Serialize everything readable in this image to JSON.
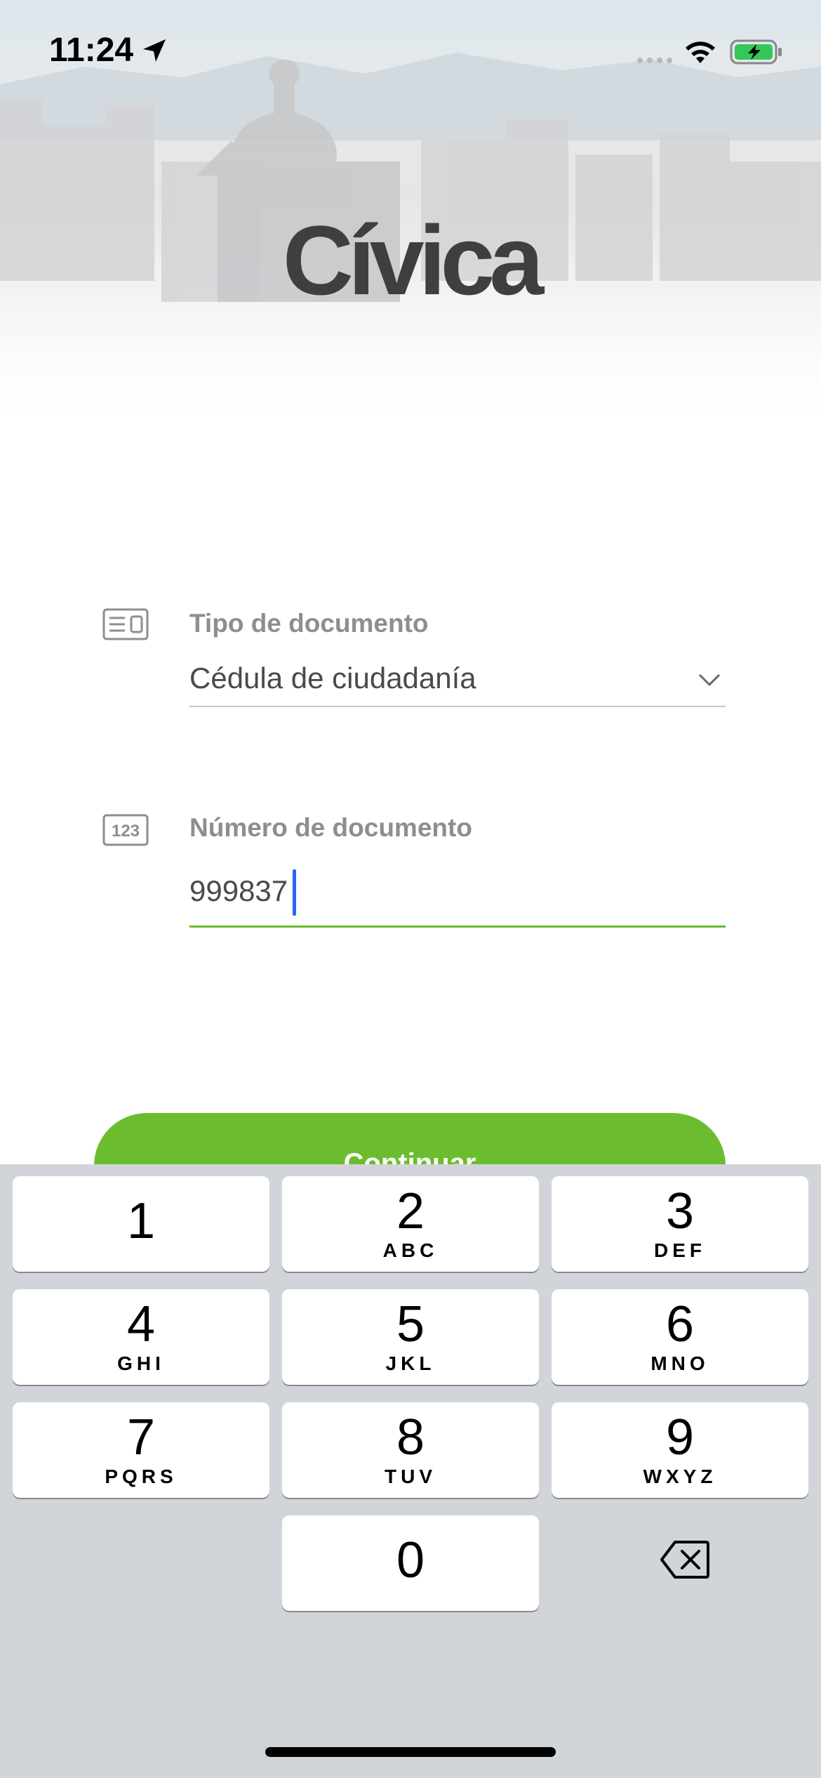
{
  "status_bar": {
    "time": "11:24"
  },
  "app": {
    "logo": "Cívica"
  },
  "form": {
    "document_type": {
      "label": "Tipo de documento",
      "value": "Cédula de ciudadanía",
      "icon": "id-card-icon"
    },
    "document_number": {
      "label": "Número de documento",
      "value": "999837",
      "icon": "numeric-123-icon"
    }
  },
  "actions": {
    "continue_label": "Continuar"
  },
  "keyboard": {
    "keys": [
      {
        "num": "1",
        "letters": ""
      },
      {
        "num": "2",
        "letters": "ABC"
      },
      {
        "num": "3",
        "letters": "DEF"
      },
      {
        "num": "4",
        "letters": "GHI"
      },
      {
        "num": "5",
        "letters": "JKL"
      },
      {
        "num": "6",
        "letters": "MNO"
      },
      {
        "num": "7",
        "letters": "PQRS"
      },
      {
        "num": "8",
        "letters": "TUV"
      },
      {
        "num": "9",
        "letters": "WXYZ"
      },
      {
        "num": "0",
        "letters": ""
      }
    ]
  },
  "colors": {
    "accent": "#6bbd2f",
    "caret": "#2a64f6",
    "logo": "#3e3f41",
    "keyboard_bg": "#d1d4d9",
    "battery": "#34c759"
  }
}
